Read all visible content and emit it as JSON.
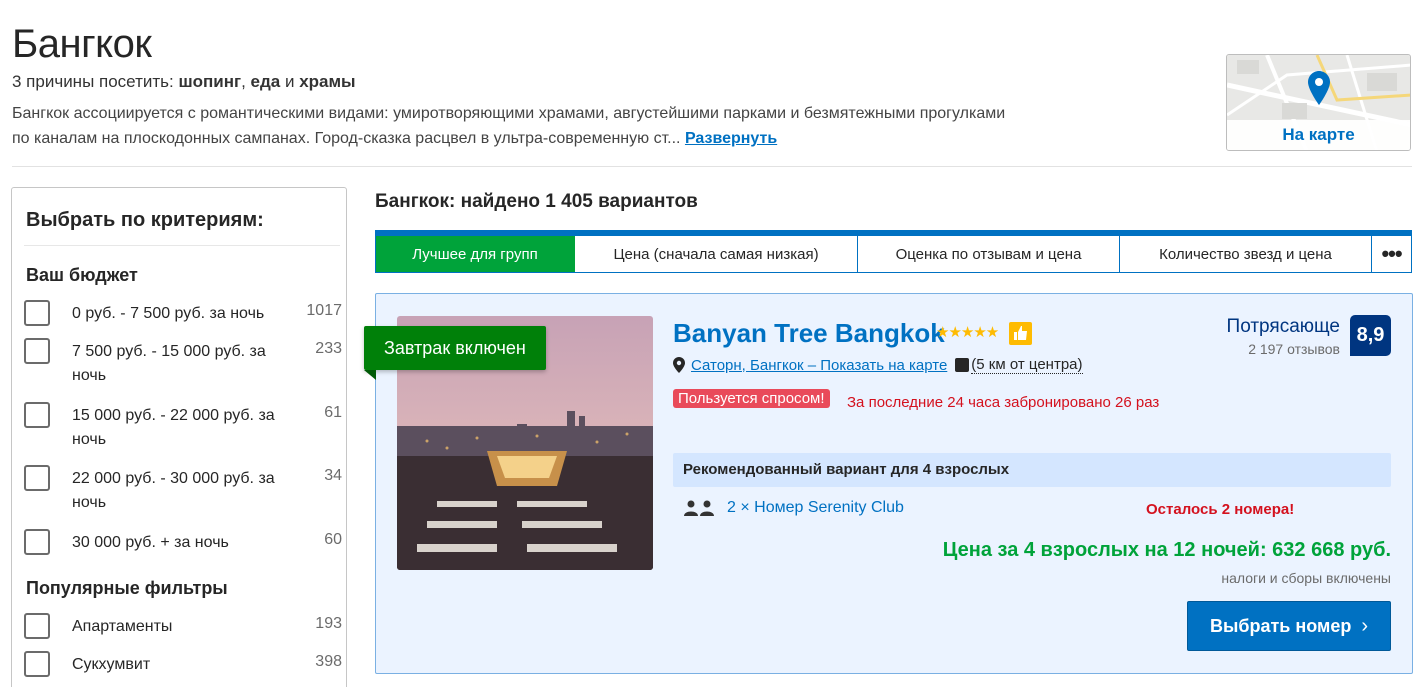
{
  "header": {
    "city": "Бангкок",
    "reasons_prefix": "3 причины посетить: ",
    "reason1": "шопинг",
    "sep1": ", ",
    "reason2": "еда",
    "sep2": " и ",
    "reason3": "храмы",
    "description_line1": "Бангкок ассоциируется с романтическими видами: умиротворяющими храмами, августейшими парками и безмятежными прогулками",
    "description_line2": "по каналам на плоскодонных сампанах. Город-сказка расцвел в ультра-современную ст...",
    "expand_link": "Развернуть",
    "map_label": "На карте"
  },
  "sidebar": {
    "title": "Выбрать по критериям:",
    "budget_title": "Ваш бюджет",
    "budget": [
      {
        "label": "0 руб. - 7 500 руб. за ночь",
        "count": "1017"
      },
      {
        "label": "7 500 руб. - 15 000 руб. за ночь",
        "count": "233"
      },
      {
        "label": "15 000 руб. - 22 000 руб. за ночь",
        "count": "61"
      },
      {
        "label": "22 000 руб. - 30 000 руб. за ночь",
        "count": "34"
      },
      {
        "label": "30 000 руб. + за ночь",
        "count": "60"
      }
    ],
    "popular_title": "Популярные фильтры",
    "popular": [
      {
        "label": "Апартаменты",
        "count": "193"
      },
      {
        "label": "Сукхумвит",
        "count": "398"
      }
    ]
  },
  "results": {
    "title": "Бангкок: найдено 1 405 вариантов",
    "sort_tabs": [
      "Лучшее для групп",
      "Цена (сначала самая низкая)",
      "Оценка по отзывам и цена",
      "Количество звезд и цена"
    ],
    "sort_more": "•••"
  },
  "hotel": {
    "ribbon": "Завтрак включен",
    "name": "Banyan Tree Bangkok",
    "stars": "★★★★★",
    "location_link": "Саторн, Бангкок – Показать на карте",
    "distance": "(5 км от центра)",
    "demand_badge": "Пользуется спросом!",
    "demand_text": "За последние 24 часа забронировано 26 раз",
    "rating_word": "Потрясающе",
    "reviews": "2 197 отзывов",
    "score": "8,9",
    "recommended": "Рекомендованный вариант для 4 взрослых",
    "room": "2 × Номер Serenity Club",
    "rooms_left": "Осталось 2 номера!",
    "price": "Цена за 4 взрослых на 12 ночей: 632 668 руб.",
    "taxes": "налоги и сборы включены",
    "select_button": "Выбрать номер"
  },
  "colors": {
    "brand_blue": "#0071c2",
    "dark_blue": "#003580",
    "green": "#00a33a",
    "ribbon_green": "#008009",
    "red": "#d4111e",
    "star_yellow": "#febb02"
  }
}
